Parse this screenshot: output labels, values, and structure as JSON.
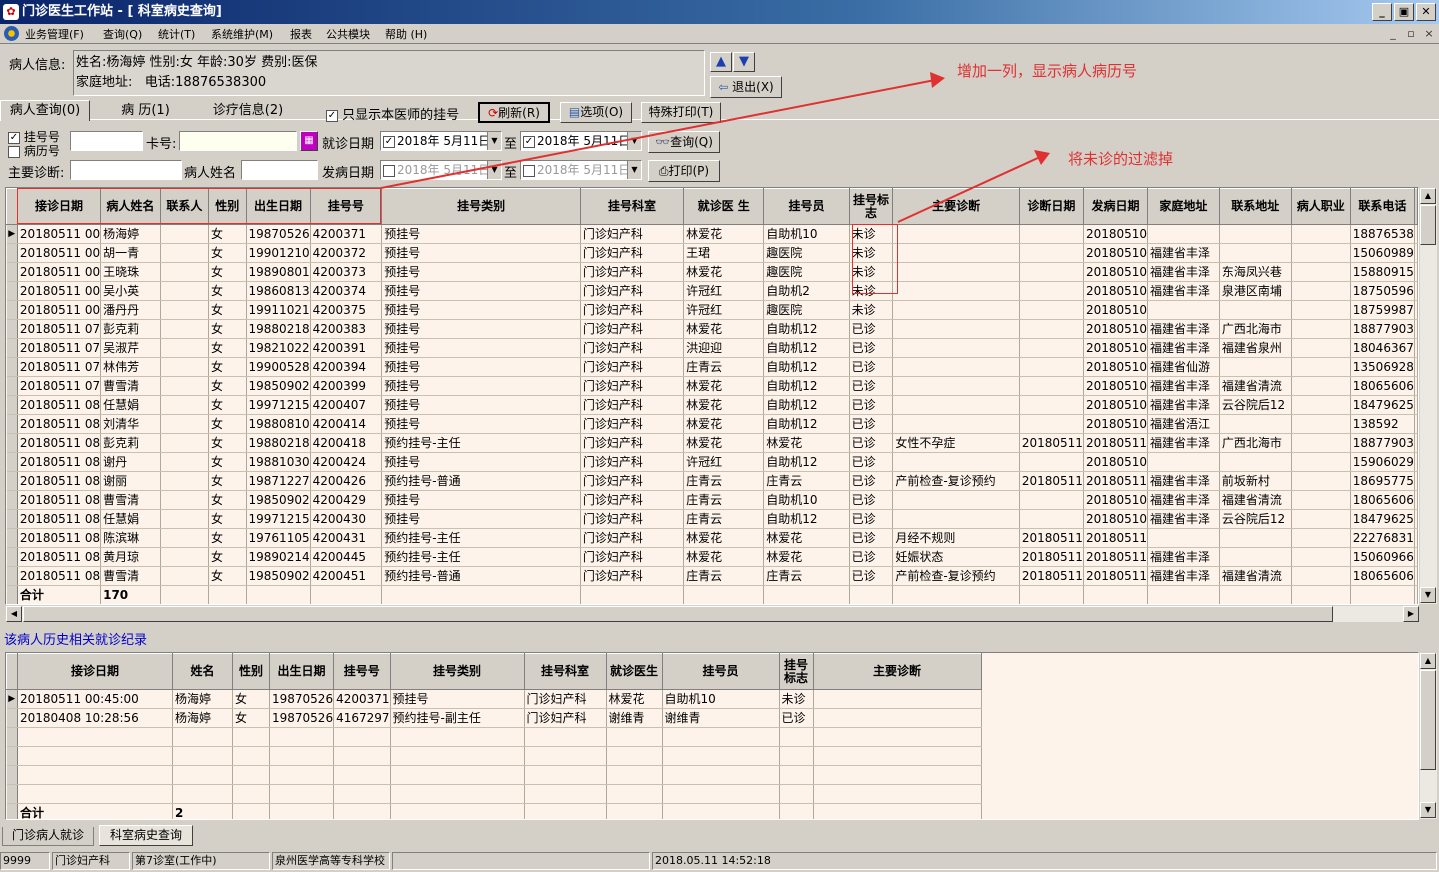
{
  "window": {
    "title": "门诊医生工作站 - [ 科室病史查询]"
  },
  "menu": [
    "业务管理(F)",
    "查询(Q)",
    "统计(T)",
    "系统维护(M)",
    "报表",
    "公共模块",
    "帮助 (H)"
  ],
  "patient_info": {
    "label": "病人信息:",
    "line1": "姓名:杨海婷 性别:女 年龄:30岁 费别:医保",
    "line2": "家庭地址:   电话:18876538300",
    "exit_label": "退出(X)"
  },
  "tabs": {
    "items": [
      "病人查询(0)",
      "病 历(1)",
      "诊疗信息(2)"
    ]
  },
  "toolbar": {
    "only_my_label": "只显示本医师的挂号",
    "refresh_label": "刷新(R)",
    "options_label": "选项(O)",
    "special_print_label": "特殊打印(T)"
  },
  "filter": {
    "reg_no_label": "挂号号",
    "record_no_label": "病历号",
    "card_label": "卡号:",
    "visit_date_label": "就诊日期",
    "date_from": "2018年 5月11日",
    "to_label": "至",
    "date_to": "2018年 5月11日",
    "query_label": "查询(Q)",
    "diagnosis_label": "主要诊断:",
    "patient_name_label": "病人姓名",
    "onset_date_label": "发病日期",
    "onset_from": "2018年 5月11日",
    "onset_to": "2018年 5月11日",
    "print_label": "打印(P)"
  },
  "main_table": {
    "headers": [
      "接诊日期",
      "病人姓名",
      "联系人",
      "性别",
      "出生日期",
      "挂号号",
      "挂号类别",
      "挂号科室",
      "就诊医 生",
      "挂号员",
      "挂号标志",
      "主要诊断",
      "诊断日期",
      "发病日期",
      "家庭地址",
      "联系地址",
      "病人职业",
      "联系电话"
    ],
    "rows": [
      [
        "20180511 00",
        "杨海婷",
        "",
        "女",
        "19870526",
        "4200371",
        "预挂号",
        "门诊妇产科",
        "林爱花",
        "自助机10",
        "未诊",
        "",
        "",
        "20180510",
        "",
        "",
        "",
        "18876538"
      ],
      [
        "20180511 00",
        "胡一青",
        "",
        "女",
        "19901210",
        "4200372",
        "预挂号",
        "门诊妇产科",
        "王珺",
        "趣医院",
        "未诊",
        "",
        "",
        "20180510",
        "福建省丰泽",
        "",
        "",
        "15060989"
      ],
      [
        "20180511 00",
        "王晓珠",
        "",
        "女",
        "19890801",
        "4200373",
        "预挂号",
        "门诊妇产科",
        "林爱花",
        "趣医院",
        "未诊",
        "",
        "",
        "20180510",
        "福建省丰泽",
        "东海凤兴巷",
        "",
        "15880915"
      ],
      [
        "20180511 00",
        "吴小英",
        "",
        "女",
        "19860813",
        "4200374",
        "预挂号",
        "门诊妇产科",
        "许冠红",
        "自助机2",
        "未诊",
        "",
        "",
        "20180510",
        "福建省丰泽",
        "泉港区南埔",
        "",
        "18750596"
      ],
      [
        "20180511 00",
        "潘丹丹",
        "",
        "女",
        "19911021",
        "4200375",
        "预挂号",
        "门诊妇产科",
        "许冠红",
        "趣医院",
        "未诊",
        "",
        "",
        "20180510",
        "",
        "",
        "",
        "18759987"
      ],
      [
        "20180511 07",
        "彭克莉",
        "",
        "女",
        "19880218",
        "4200383",
        "预挂号",
        "门诊妇产科",
        "林爱花",
        "自助机12",
        "已诊",
        "",
        "",
        "20180510",
        "福建省丰泽",
        "广西北海市",
        "",
        "18877903"
      ],
      [
        "20180511 07",
        "吴淑芹",
        "",
        "女",
        "19821022",
        "4200391",
        "预挂号",
        "门诊妇产科",
        "洪迎迎",
        "自助机12",
        "已诊",
        "",
        "",
        "20180510",
        "福建省丰泽",
        "福建省泉州",
        "",
        "18046367"
      ],
      [
        "20180511 07",
        "林伟芳",
        "",
        "女",
        "19900528",
        "4200394",
        "预挂号",
        "门诊妇产科",
        "庄青云",
        "自助机12",
        "已诊",
        "",
        "",
        "20180510",
        "福建省仙游",
        "",
        "",
        "13506928"
      ],
      [
        "20180511 07",
        "曹雪清",
        "",
        "女",
        "19850902",
        "4200399",
        "预挂号",
        "门诊妇产科",
        "林爱花",
        "自助机12",
        "已诊",
        "",
        "",
        "20180510",
        "福建省丰泽",
        "福建省清流",
        "",
        "18065606"
      ],
      [
        "20180511 08",
        "任慧娟",
        "",
        "女",
        "19971215",
        "4200407",
        "预挂号",
        "门诊妇产科",
        "林爱花",
        "自助机12",
        "已诊",
        "",
        "",
        "20180510",
        "福建省丰泽",
        "云谷院后12",
        "",
        "18479625"
      ],
      [
        "20180511 08",
        "刘清华",
        "",
        "女",
        "19880810",
        "4200414",
        "预挂号",
        "门诊妇产科",
        "林爱花",
        "自助机12",
        "已诊",
        "",
        "",
        "20180510",
        "福建省浯江",
        "",
        "",
        "138592"
      ],
      [
        "20180511 08",
        "彭克莉",
        "",
        "女",
        "19880218",
        "4200418",
        "预约挂号-主任",
        "门诊妇产科",
        "林爱花",
        "林爱花",
        "已诊",
        "女性不孕症",
        "20180511",
        "20180511",
        "福建省丰泽",
        "广西北海市",
        "",
        "18877903"
      ],
      [
        "20180511 08",
        "谢丹",
        "",
        "女",
        "19881030",
        "4200424",
        "预挂号",
        "门诊妇产科",
        "许冠红",
        "自助机12",
        "已诊",
        "",
        "",
        "20180510",
        "",
        "",
        "",
        "15906029"
      ],
      [
        "20180511 08",
        "谢丽",
        "",
        "女",
        "19871227",
        "4200426",
        "预约挂号-普通",
        "门诊妇产科",
        "庄青云",
        "庄青云",
        "已诊",
        "产前检查-复诊预约",
        "20180511",
        "20180511",
        "福建省丰泽",
        "前坂新村",
        "",
        "18695775"
      ],
      [
        "20180511 08",
        "曹雪清",
        "",
        "女",
        "19850902",
        "4200429",
        "预挂号",
        "门诊妇产科",
        "庄青云",
        "自助机10",
        "已诊",
        "",
        "",
        "20180510",
        "福建省丰泽",
        "福建省清流",
        "",
        "18065606"
      ],
      [
        "20180511 08",
        "任慧娟",
        "",
        "女",
        "19971215",
        "4200430",
        "预挂号",
        "门诊妇产科",
        "庄青云",
        "自助机12",
        "已诊",
        "",
        "",
        "20180510",
        "福建省丰泽",
        "云谷院后12",
        "",
        "18479625"
      ],
      [
        "20180511 08",
        "陈滨琳",
        "",
        "女",
        "19761105",
        "4200431",
        "预约挂号-主任",
        "门诊妇产科",
        "林爱花",
        "林爱花",
        "已诊",
        "月经不规则",
        "20180511",
        "20180511",
        "",
        "",
        "",
        "22276831"
      ],
      [
        "20180511 08",
        "黄月琼",
        "",
        "女",
        "19890214",
        "4200445",
        "预约挂号-主任",
        "门诊妇产科",
        "林爱花",
        "林爱花",
        "已诊",
        "妊娠状态",
        "20180511",
        "20180511",
        "福建省丰泽",
        "",
        "",
        "15060966"
      ],
      [
        "20180511 08",
        "曹雪清",
        "",
        "女",
        "19850902",
        "4200451",
        "预约挂号-普通",
        "门诊妇产科",
        "庄青云",
        "庄青云",
        "已诊",
        "产前检查-复诊预约",
        "20180511",
        "20180511",
        "福建省丰泽",
        "福建省清流",
        "",
        "18065606"
      ]
    ],
    "total_label": "合计",
    "total_count": "170"
  },
  "history": {
    "title": "该病人历史相关就诊纪录",
    "headers": [
      "接诊日期",
      "姓名",
      "性别",
      "出生日期",
      "挂号号",
      "挂号类别",
      "挂号科室",
      "就诊医生",
      "挂号员",
      "挂号标志",
      "主要诊断"
    ],
    "rows": [
      [
        "20180511 00:45:00",
        "杨海婷",
        "女",
        "19870526",
        "4200371",
        "预挂号",
        "门诊妇产科",
        "林爱花",
        "自助机10",
        "未诊",
        ""
      ],
      [
        "20180408 10:28:56",
        "杨海婷",
        "女",
        "19870526",
        "4167297",
        "预约挂号-副主任",
        "门诊妇产科",
        "谢维青",
        "谢维青",
        "已诊",
        ""
      ]
    ],
    "total_label": "合计",
    "total_count": "2"
  },
  "annotations": {
    "add_column": "增加一列，显示病人病历号",
    "filter_unvisited": "将未诊的过滤掉"
  },
  "bottom_tabs": [
    "门诊病人就诊",
    "科室病史查询"
  ],
  "statusbar": [
    "9999",
    "门诊妇产科",
    "第7诊室(工作中)",
    "泉州医学高等专科学校",
    "2018.05.11 14:52:18"
  ],
  "colors": {
    "title_bar": "#0a246a",
    "annotation": "#e03030",
    "grid_bg": "#fdf3ea",
    "link_blue": "#0000cc"
  }
}
